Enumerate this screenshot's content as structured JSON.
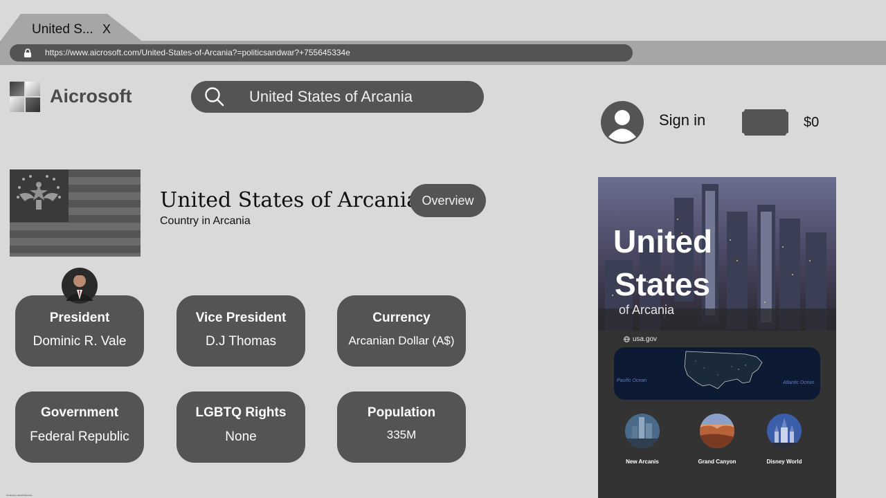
{
  "browser": {
    "tab_title": "United S...",
    "tab_close": "X",
    "url": "https://www.aicrosoft.com/United-States-of-Arcania?=politicsandwar?+755645334e"
  },
  "header": {
    "logo_text": "Aicrosoft",
    "search_value": "United States of Arcania",
    "signin_label": "Sign in",
    "balance": "$0"
  },
  "entity": {
    "title": "United States of Arcania",
    "subtitle": "Country in Arcania",
    "overview_label": "Overview"
  },
  "facts": [
    {
      "label": "President",
      "value": "Dominic R. Vale"
    },
    {
      "label": "Vice President",
      "value": "D.J Thomas"
    },
    {
      "label": "Currency",
      "value": "Arcanian Dollar (A$)"
    },
    {
      "label": "Government",
      "value": "Federal Republic"
    },
    {
      "label": "LGBTQ Rights",
      "value": "None"
    },
    {
      "label": "Population",
      "value": "335M"
    }
  ],
  "panel": {
    "hero_line1": "United",
    "hero_line2": "States",
    "hero_line3": "of Arcania",
    "site": "usa.gov",
    "map_labels": {
      "left": "Pacific Ocean",
      "right": "Atlantic Ocean"
    },
    "places": [
      {
        "label": "New Arcanis"
      },
      {
        "label": "Grand Canyon"
      },
      {
        "label": "Disney World"
      }
    ]
  },
  "footer": {
    "credit": "Created by Jewish Ruoness"
  }
}
